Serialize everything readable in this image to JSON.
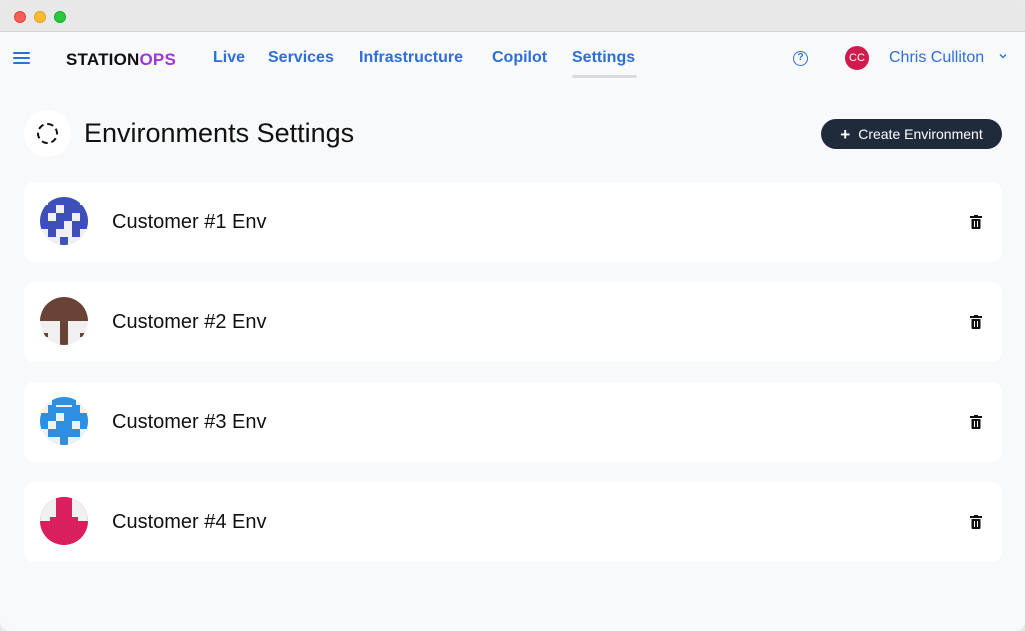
{
  "app": {
    "logo_part1": "STATION",
    "logo_part2": "OPS",
    "brand_color": "#a035d8",
    "accent_color": "#2d6fd6"
  },
  "nav": {
    "links": [
      "Live",
      "Services",
      "Infrastructure",
      "Copilot",
      "Settings"
    ],
    "active": "Settings",
    "help_icon": "question-circle-icon",
    "user": {
      "initials": "CC",
      "name": "Chris Culliton",
      "avatar_color": "#cf1c4e"
    }
  },
  "page": {
    "title": "Environments Settings",
    "title_icon": "dashed-circle-icon",
    "create_button_icon": "+",
    "create_button_label": "Create Environment"
  },
  "environments": [
    {
      "name": "Customer #1 Env",
      "avatar_color": "#3d4fb8",
      "delete_icon": "trash-icon"
    },
    {
      "name": "Customer #2 Env",
      "avatar_color": "#6b4336",
      "delete_icon": "trash-icon"
    },
    {
      "name": "Customer #3 Env",
      "avatar_color": "#2e8ee0",
      "delete_icon": "trash-icon"
    },
    {
      "name": "Customer #4 Env",
      "avatar_color": "#da1f5e",
      "delete_icon": "trash-icon"
    }
  ]
}
